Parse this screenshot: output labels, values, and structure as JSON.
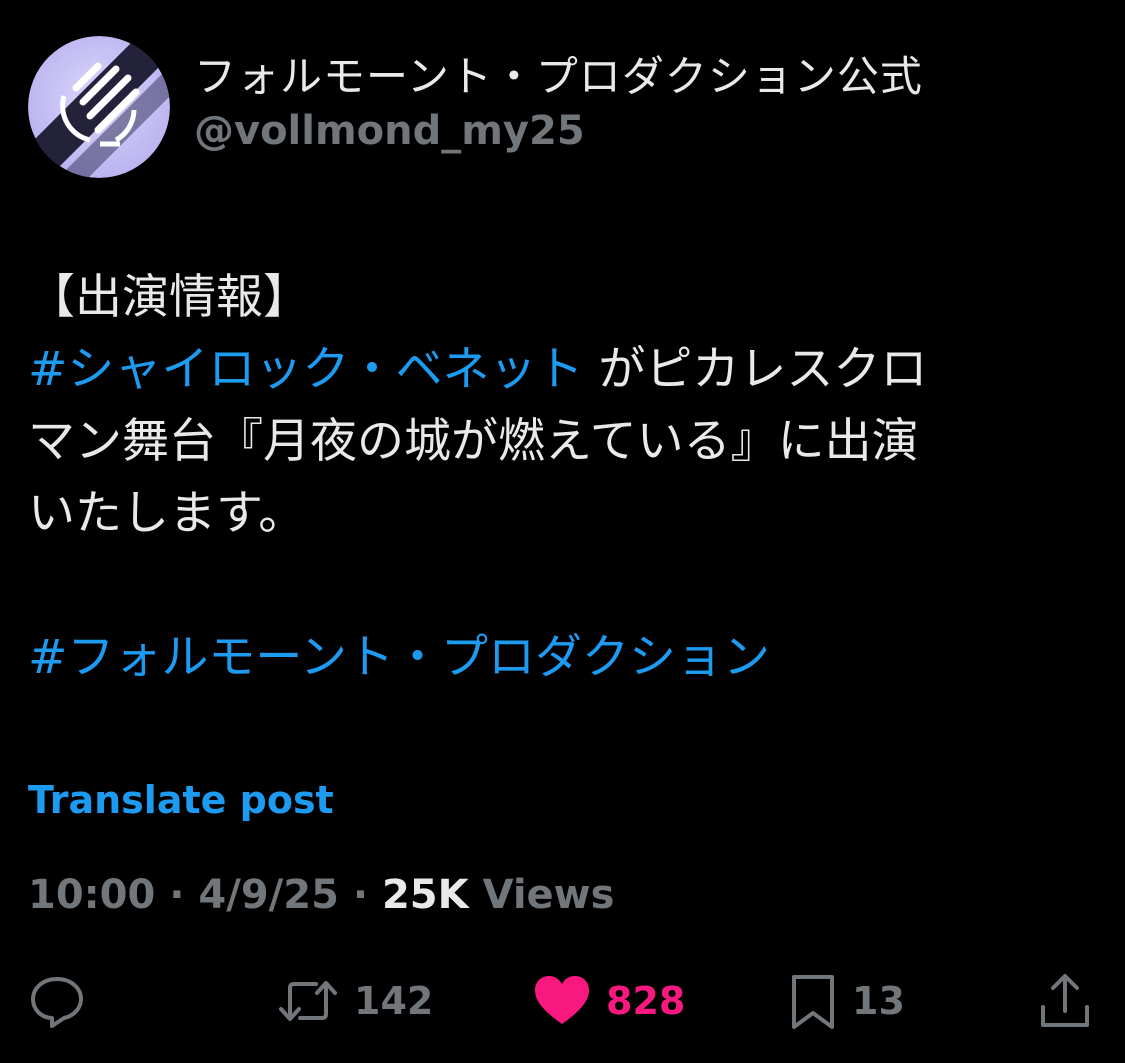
{
  "account": {
    "display_name": "フォルモーント・プロダクション公式",
    "handle": "@vollmond_my25"
  },
  "post": {
    "line1": "【出演情報】",
    "hashtag1": "#シャイロック・ベネット",
    "line2_rest": " がピカレスクロ",
    "line3": "マン舞台『月夜の城が燃えている』に出演",
    "line4": "いたします。",
    "hashtag2": "#フォルモーント・プロダクション"
  },
  "translate_label": "Translate post",
  "meta": {
    "time": "10:00",
    "separator1": " · ",
    "date": "4/9/25",
    "separator2": " · ",
    "views_count": "25K",
    "views_label": " Views"
  },
  "actions": {
    "reply": {
      "icon": "reply-icon",
      "count": ""
    },
    "repost": {
      "icon": "repost-icon",
      "count": "142"
    },
    "like": {
      "icon": "heart-icon",
      "count": "828",
      "active": true
    },
    "bookmark": {
      "icon": "bookmark-icon",
      "count": "13"
    },
    "share": {
      "icon": "share-icon",
      "count": ""
    }
  },
  "colors": {
    "background": "#000000",
    "text": "#e7e9ea",
    "secondary": "#71767b",
    "link": "#1d9bf0",
    "like": "#f91880",
    "avatar_bg": "#c9c4f3"
  }
}
